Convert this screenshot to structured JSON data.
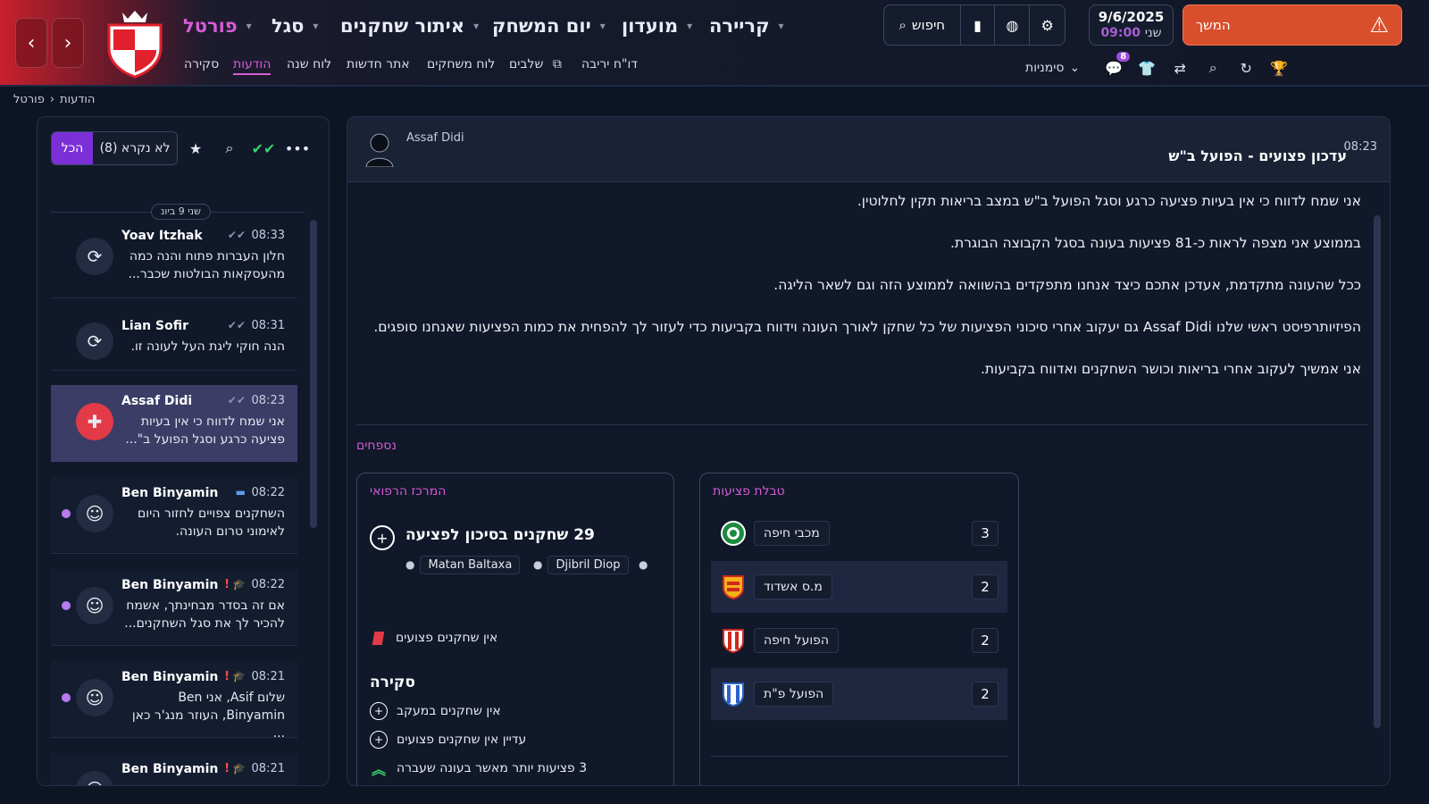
{
  "nav": {
    "back_icon": "chevron-left-icon",
    "forward_icon": "chevron-right-icon",
    "main": [
      {
        "label": "פורטל",
        "active": true
      },
      {
        "label": "סגל"
      },
      {
        "label": "איתור שחקנים"
      },
      {
        "label": "יום המשחק"
      },
      {
        "label": "מועדון"
      },
      {
        "label": "קריירה"
      }
    ],
    "sub": [
      {
        "label": "סקירה"
      },
      {
        "label": "הודעות",
        "active": true
      },
      {
        "label": "לוח שנה"
      },
      {
        "label": "אתר חדשות"
      },
      {
        "label": "לוח משחקים"
      },
      {
        "label": "שלבים"
      },
      {
        "label": "דו\"ח יריבה"
      }
    ]
  },
  "tools": {
    "search_label": "חיפוש",
    "date": "9/6/2025",
    "day": "שני",
    "time": "09:00",
    "continue_label": "המשך"
  },
  "shortcuts": {
    "label": "סימניות",
    "message_badge": "8"
  },
  "breadcrumb": {
    "root": "פורטל",
    "current": "הודעות"
  },
  "inbox": {
    "filter_all": "הכל",
    "filter_unread": "לא נקרא (8)",
    "day_label": "שני 9 ביונ",
    "messages": [
      {
        "sender": "Yoav Itzhak",
        "time": "08:33",
        "preview": "חלון העברות פתוח והנה כמה מהעסקאות הבולטות שכבר..."
      },
      {
        "sender": "Lian Sofir",
        "time": "08:31",
        "preview": "הנה חוקי ליגת העל לעונה זו."
      },
      {
        "sender": "Assaf Didi",
        "time": "08:23",
        "preview": "אני שמח לדווח כי אין בעיות פציעה כרגע וסגל הפועל ב\"..."
      },
      {
        "sender": "Ben Binyamin",
        "time": "08:22",
        "preview": "השחקנים צפויים לחזור היום לאימוני טרום העונה."
      },
      {
        "sender": "Ben Binyamin",
        "time": "08:22",
        "preview": "אם זה בסדר מבחינתך, אשמח להכיר לך את סגל השחקנים..."
      },
      {
        "sender": "Ben Binyamin",
        "time": "08:21",
        "preview": "שלום Asif, אני Ben Binyamin, העוזר מנג'ר כאן ..."
      },
      {
        "sender": "Ben Binyamin",
        "time": "08:21",
        "preview": ""
      }
    ]
  },
  "message": {
    "sender": "Assaf Didi",
    "subject": "עדכון פצועים - הפועל ב\"ש",
    "time": "08:23",
    "paragraphs": [
      "אני שמח לדווח כי אין בעיות פציעה כרגע וסגל הפועל ב\"ש במצב בריאות תקין לחלוטין.",
      "בממוצע אני מצפה לראות כ-81 פציעות בעונה בסגל הקבוצה הבוגרת.",
      "ככל שהעונה מתקדמת, אעדכן אתכם כיצד אנחנו מתפקדים בהשוואה לממוצע הזה וגם לשאר הליגה.",
      "הפיזיותרפיסט ראשי שלנו Assaf Didi גם יעקוב אחרי סיכוני הפציעות של כל שחקן לאורך העונה וידווח בקביעות כדי לעזור לך להפחית את כמות הפציעות שאנחנו סופגים.",
      "אני אמשיך לעקוב אחרי בריאות וכושר השחקנים ואדווח בקביעות."
    ],
    "attachments_label": "נספחים"
  },
  "medical": {
    "title": "המרכז הרפואי",
    "risk_title": "29 שחקנים בסיכון לפציעה",
    "risk_players": [
      "Matan Baltaxa",
      "Djibril Diop"
    ],
    "no_injured": "אין שחקנים פצועים",
    "overview_title": "סקירה",
    "overview": [
      "אין שחקנים במעקב",
      "עדיין אין שחקנים פצועים",
      "3 פציעות יותר מאשר בעונה שעברה"
    ]
  },
  "injury_table": {
    "title": "טבלת פציעות",
    "rows": [
      {
        "team": "מכבי חיפה",
        "count": "3"
      },
      {
        "team": "מ.ס אשדוד",
        "count": "2"
      },
      {
        "team": "הפועל חיפה",
        "count": "2"
      },
      {
        "team": "הפועל פ\"ת",
        "count": "2"
      }
    ]
  },
  "colors": {
    "accent": "#d65bd6",
    "primary_purple": "#7b2fd6",
    "continue_orange": "#d94f2c",
    "success_green": "#3ad16a",
    "danger_red": "#e23a47"
  }
}
